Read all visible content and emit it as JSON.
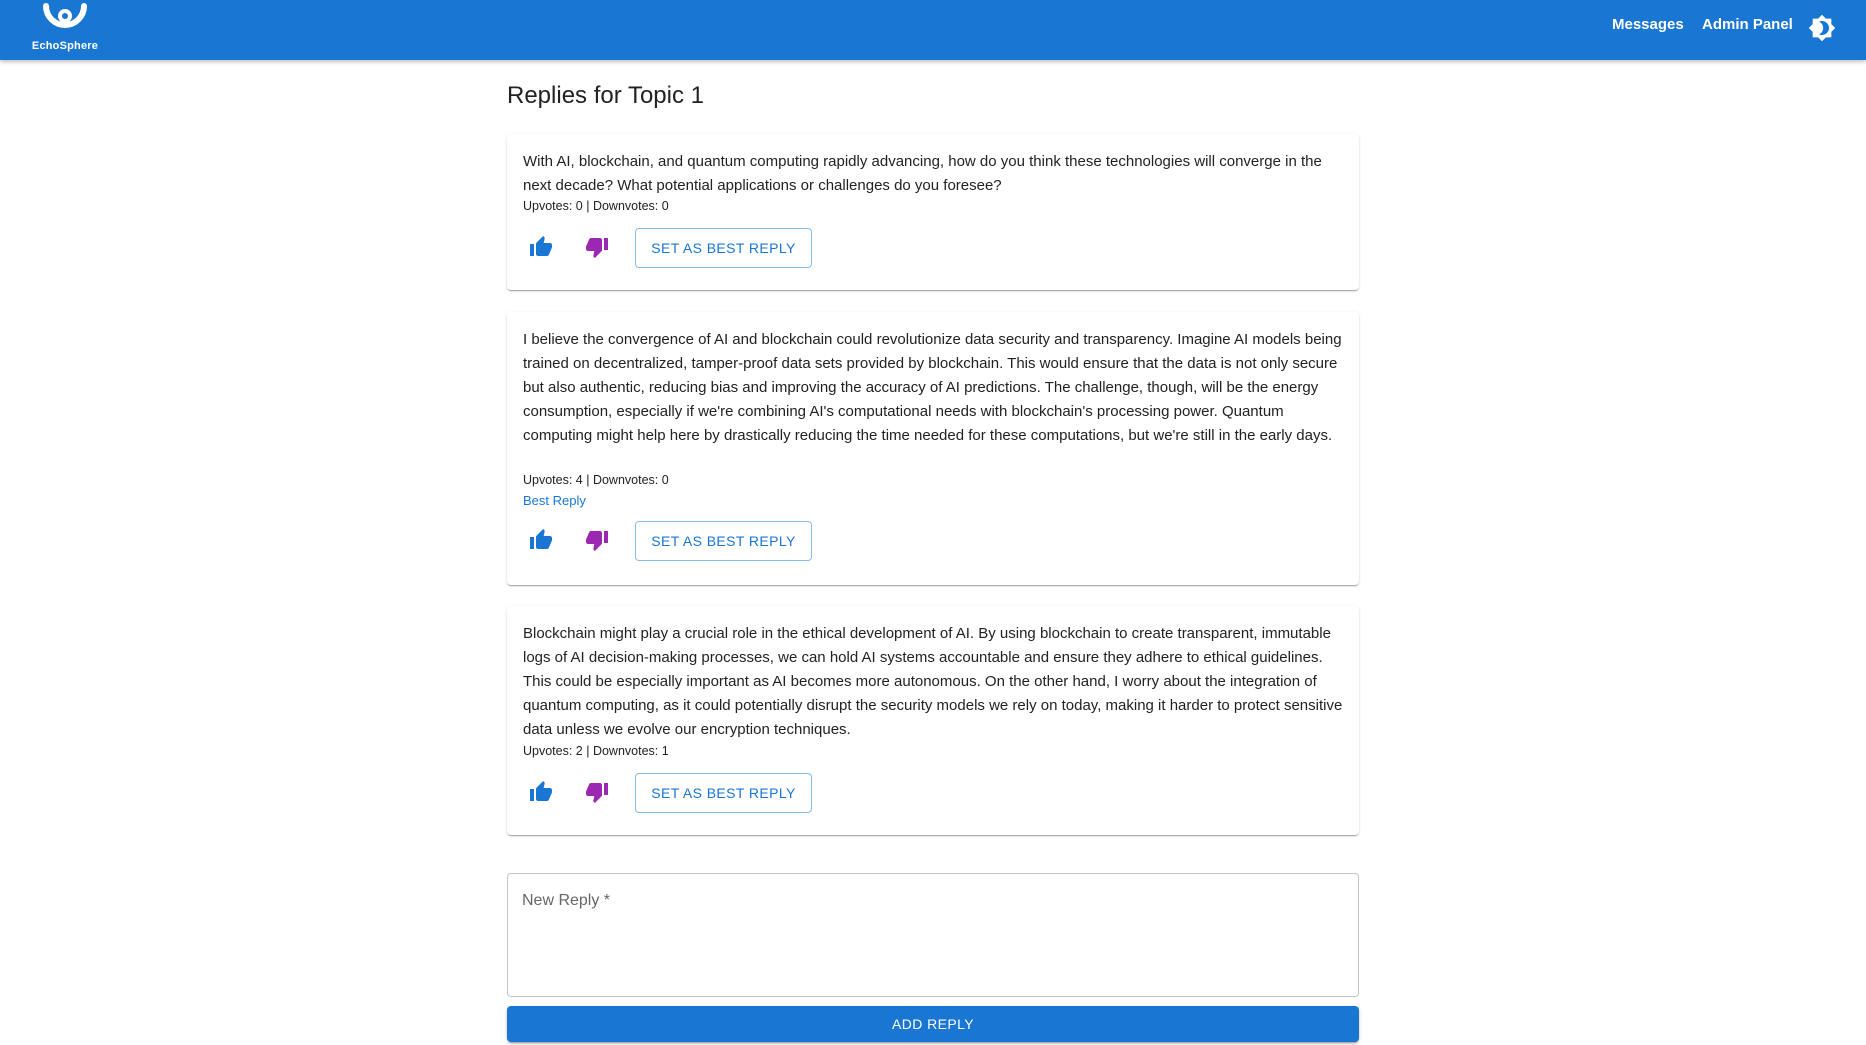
{
  "header": {
    "brand": "EchoSphere",
    "nav": [
      {
        "label": "Messages"
      },
      {
        "label": "Admin Panel"
      }
    ],
    "theme_icon": "brightness-icon",
    "color": "#1976d2"
  },
  "page": {
    "title": "Replies for Topic 1"
  },
  "replies": [
    {
      "text": "With AI, blockchain, and quantum computing rapidly advancing, how do you think these technologies will converge in the next decade? What potential applications or challenges do you foresee?",
      "votes": "Upvotes: 0 | Downvotes: 0",
      "best_label": "",
      "best_button": "SET AS BEST REPLY"
    },
    {
      "text": "I believe the convergence of AI and blockchain could revolutionize data security and transparency. Imagine AI models being trained on decentralized, tamper-proof data sets provided by blockchain. This would ensure that the data is not only secure but also authentic, reducing bias and improving the accuracy of AI predictions. The challenge, though, will be the energy consumption, especially if we're combining AI's computational needs with blockchain's processing power. Quantum computing might help here by drastically reducing the time needed for these computations, but we're still in the early days.",
      "votes": "Upvotes: 4 | Downvotes: 0",
      "best_label": "Best Reply",
      "best_button": "SET AS BEST REPLY"
    },
    {
      "text": "Blockchain might play a crucial role in the ethical development of AI. By using blockchain to create transparent, immutable logs of AI decision-making processes, we can hold AI systems accountable and ensure they adhere to ethical guidelines. This could be especially important as AI becomes more autonomous. On the other hand, I worry about the integration of quantum computing, as it could potentially disrupt the security models we rely on today, making it harder to protect sensitive data unless we evolve our encryption techniques.",
      "votes": "Upvotes: 2 | Downvotes: 1",
      "best_label": "",
      "best_button": "SET AS BEST REPLY"
    }
  ],
  "icons": {
    "upvote": "thumb-up-icon",
    "downvote": "thumb-down-icon",
    "upvote_color": "#1976d2",
    "downvote_color": "#9c27b0"
  },
  "new_reply": {
    "placeholder": "New Reply *",
    "value": "",
    "submit_label": "ADD REPLY"
  }
}
